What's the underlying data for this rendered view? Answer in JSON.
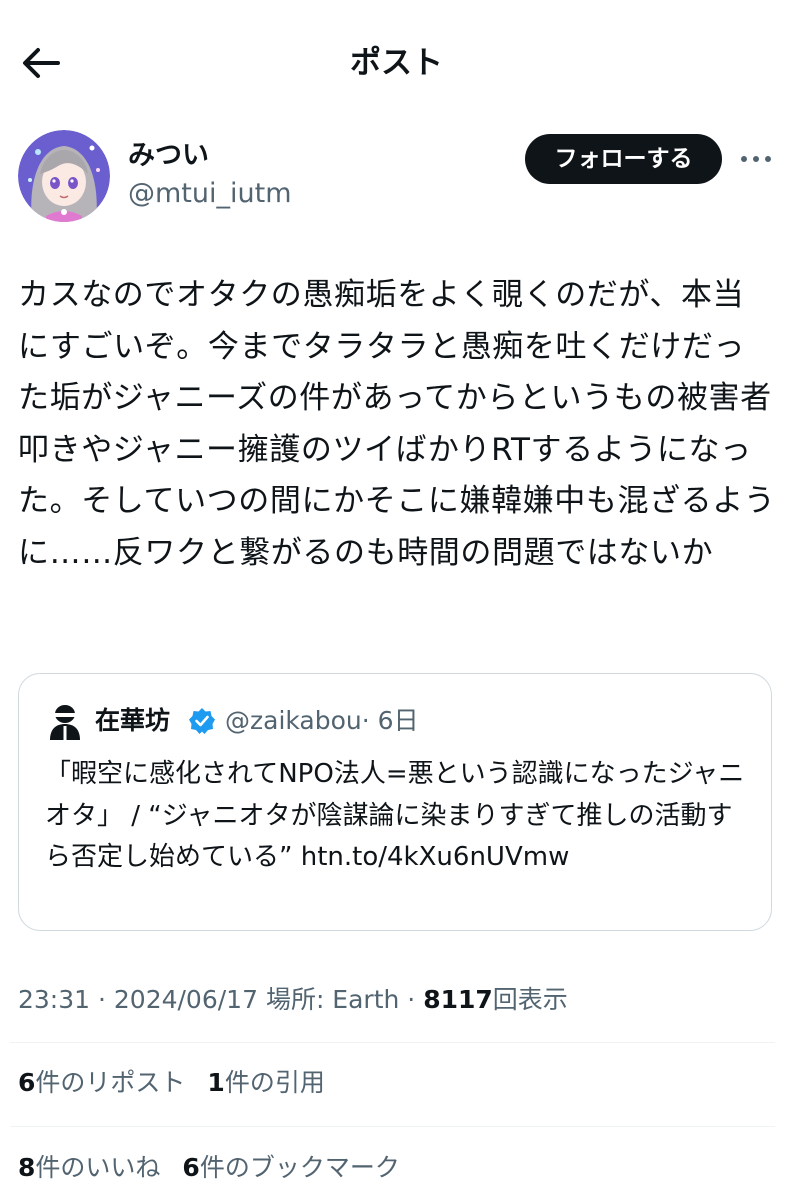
{
  "header": {
    "title": "ポスト",
    "back_icon": "arrow-left-icon"
  },
  "author": {
    "display_name": "みつい",
    "handle": "@mtui_iutm",
    "follow_label": "フォローする",
    "more_icon": "more-horizontal-icon"
  },
  "post": {
    "text": "カスなのでオタクの愚痴垢をよく覗くのだが、本当にすごいぞ。今までタラタラと愚痴を吐くだけだった垢がジャニーズの件があってからというもの被害者叩きやジャニー擁護のツイばかりRTするようになった。そしていつの間にかそこに嫌韓嫌中も混ざるように……反ワクと繋がるのも時間の問題ではないか"
  },
  "quote": {
    "name": "在華坊",
    "handle": "@zaikabou",
    "time": "· 6日",
    "verified_icon": "verified-badge-icon",
    "text": "「暇空に感化されてNPO法人=悪という認識になったジャニオタ」 / “ジャニオタが陰謀論に染まりすぎて推しの活動すら否定し始めている” htn.to/4kXu6nUVmw"
  },
  "meta": {
    "time": "23:31",
    "sep1": " · ",
    "date": "2024/06/17",
    "location_label": "場所: Earth",
    "sep2": " · ",
    "views_count": "8117",
    "views_label": "回表示"
  },
  "stats": {
    "reposts_count": "6",
    "reposts_label": "件のリポスト",
    "quotes_count": "1",
    "quotes_label": "件の引用",
    "likes_count": "8",
    "likes_label": "件のいいね",
    "bookmarks_count": "6",
    "bookmarks_label": "件のブックマーク"
  },
  "colors": {
    "text": "#0f1419",
    "secondary": "#536471",
    "border": "#cfd9de",
    "verified": "#1d9bf0"
  }
}
